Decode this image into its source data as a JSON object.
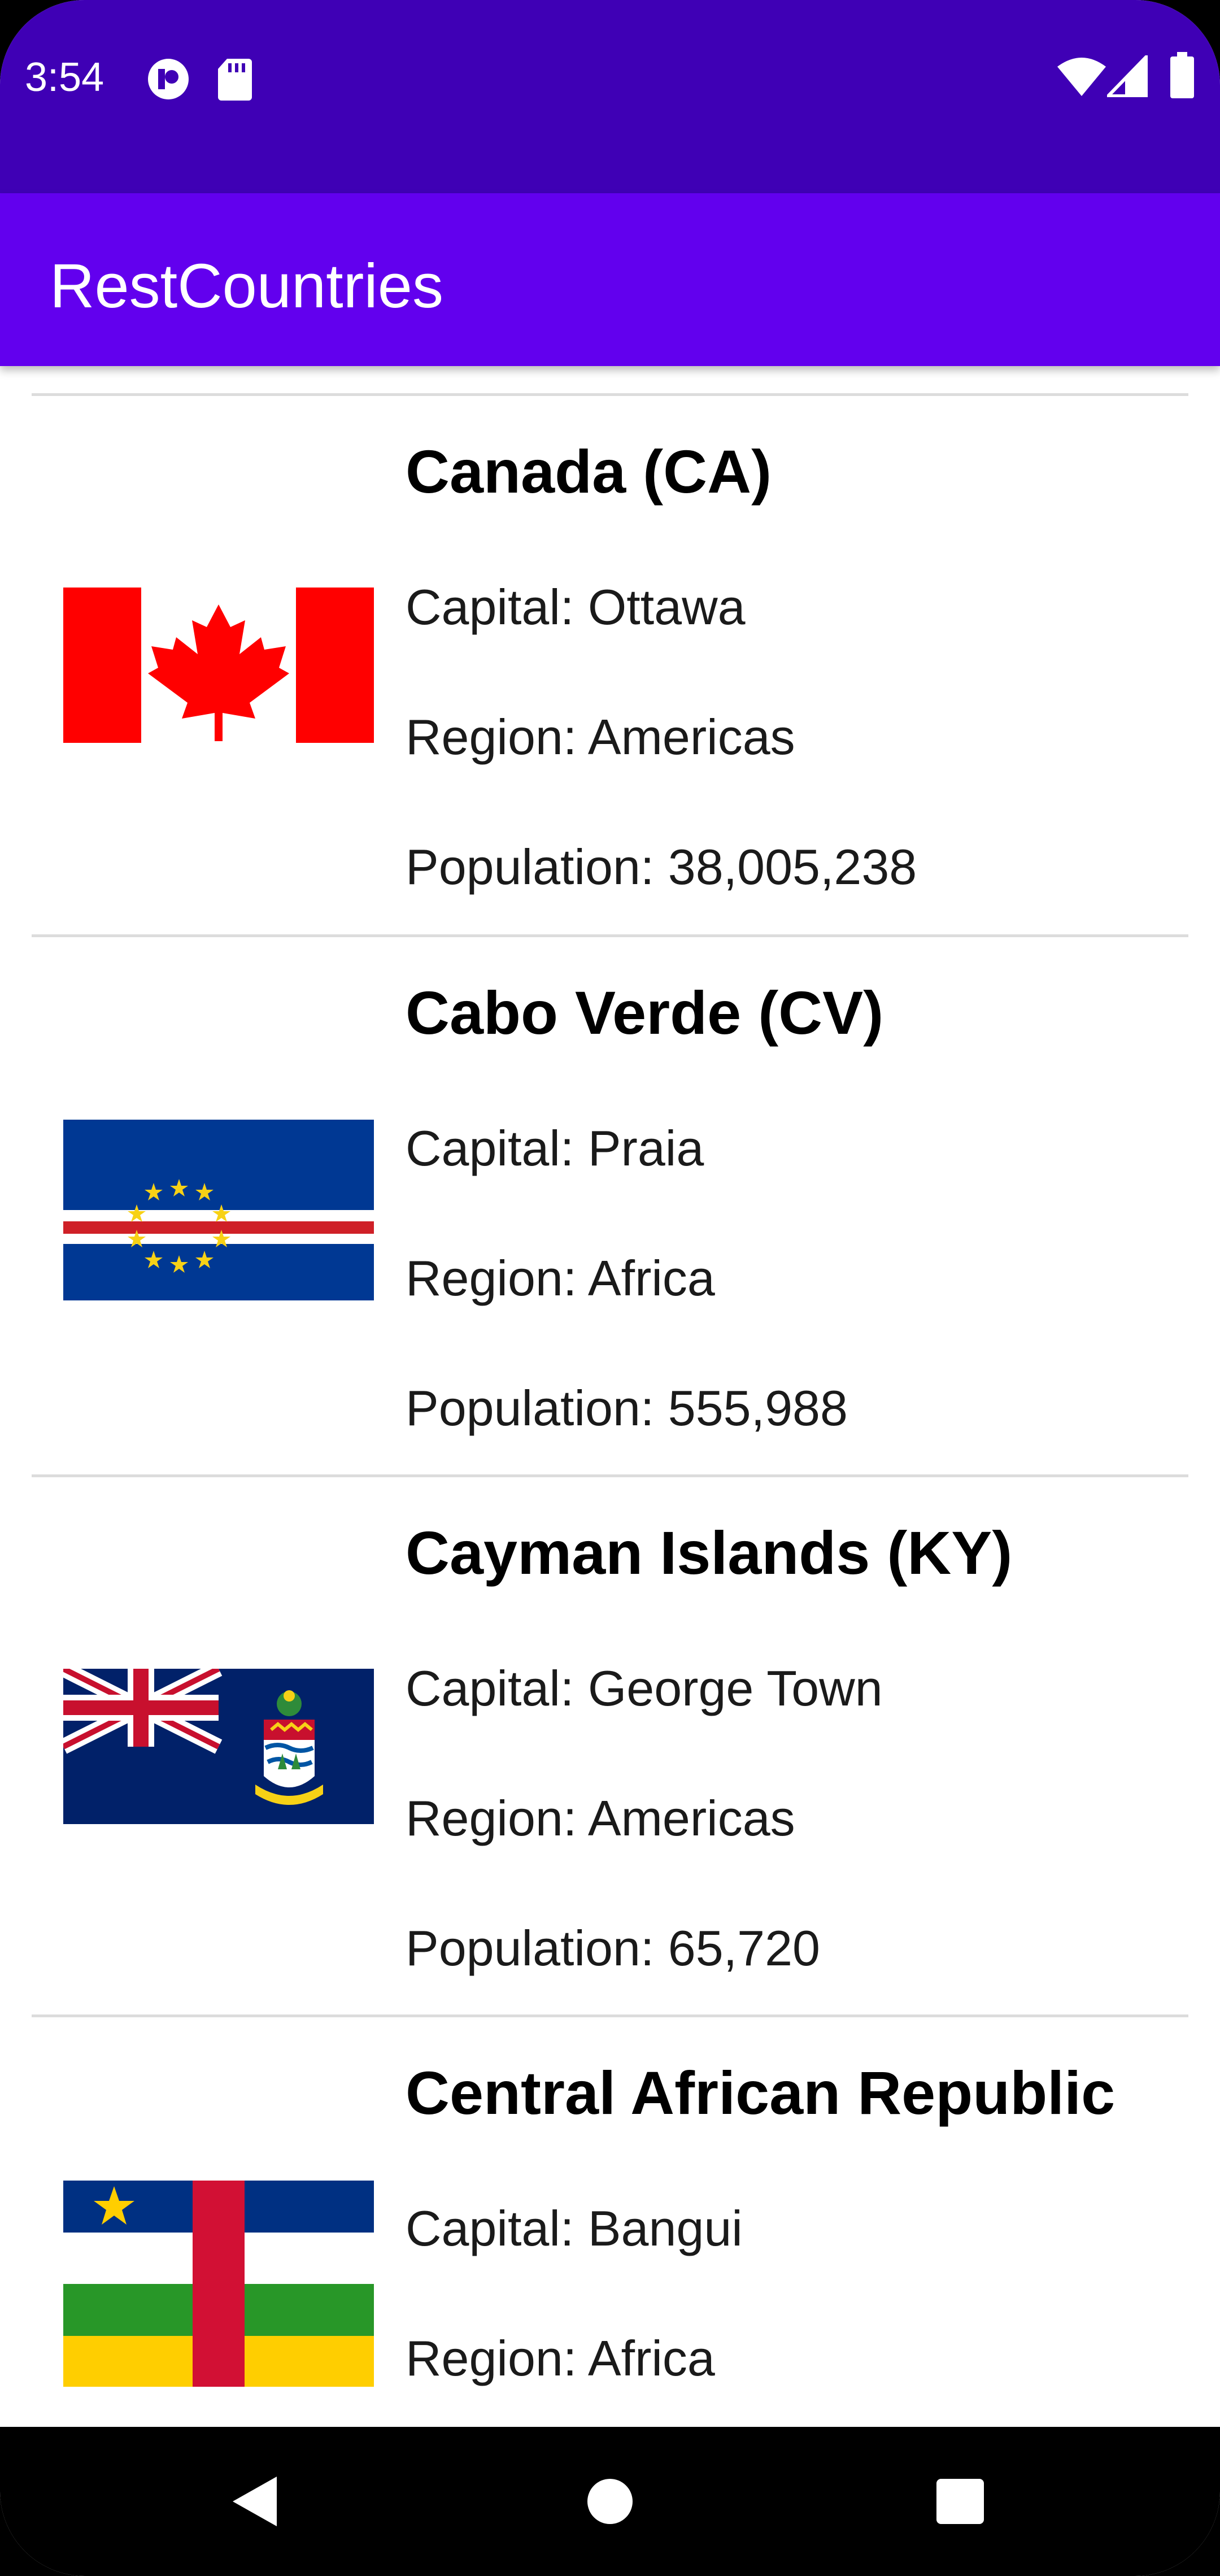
{
  "status_bar": {
    "time": "3:54",
    "left_icons": [
      "notification-app-icon",
      "sd-card-icon"
    ],
    "right_icons": [
      "wifi-icon",
      "cell-signal-icon",
      "battery-icon"
    ]
  },
  "app_bar": {
    "title": "RestCountries",
    "color": "#6200EE",
    "status_color": "#3F00B5"
  },
  "labels": {
    "capital": "Capital: ",
    "region": "Region: ",
    "population": "Population: "
  },
  "countries": [
    {
      "name": "Canada (CA)",
      "capital": "Ottawa",
      "region": "Americas",
      "population": "38,005,238",
      "flag": "canada-flag"
    },
    {
      "name": "Cabo Verde (CV)",
      "capital": "Praia",
      "region": "Africa",
      "population": "555,988",
      "flag": "cabo-verde-flag"
    },
    {
      "name": "Cayman Islands (KY)",
      "capital": "George Town",
      "region": "Americas",
      "population": "65,720",
      "flag": "cayman-islands-flag"
    },
    {
      "name": "Central African Republic",
      "capital": "Bangui",
      "region": "Africa",
      "population": "",
      "flag": "central-african-republic-flag"
    }
  ],
  "nav_bar": {
    "buttons": [
      "back-icon",
      "home-icon",
      "recents-icon"
    ]
  }
}
